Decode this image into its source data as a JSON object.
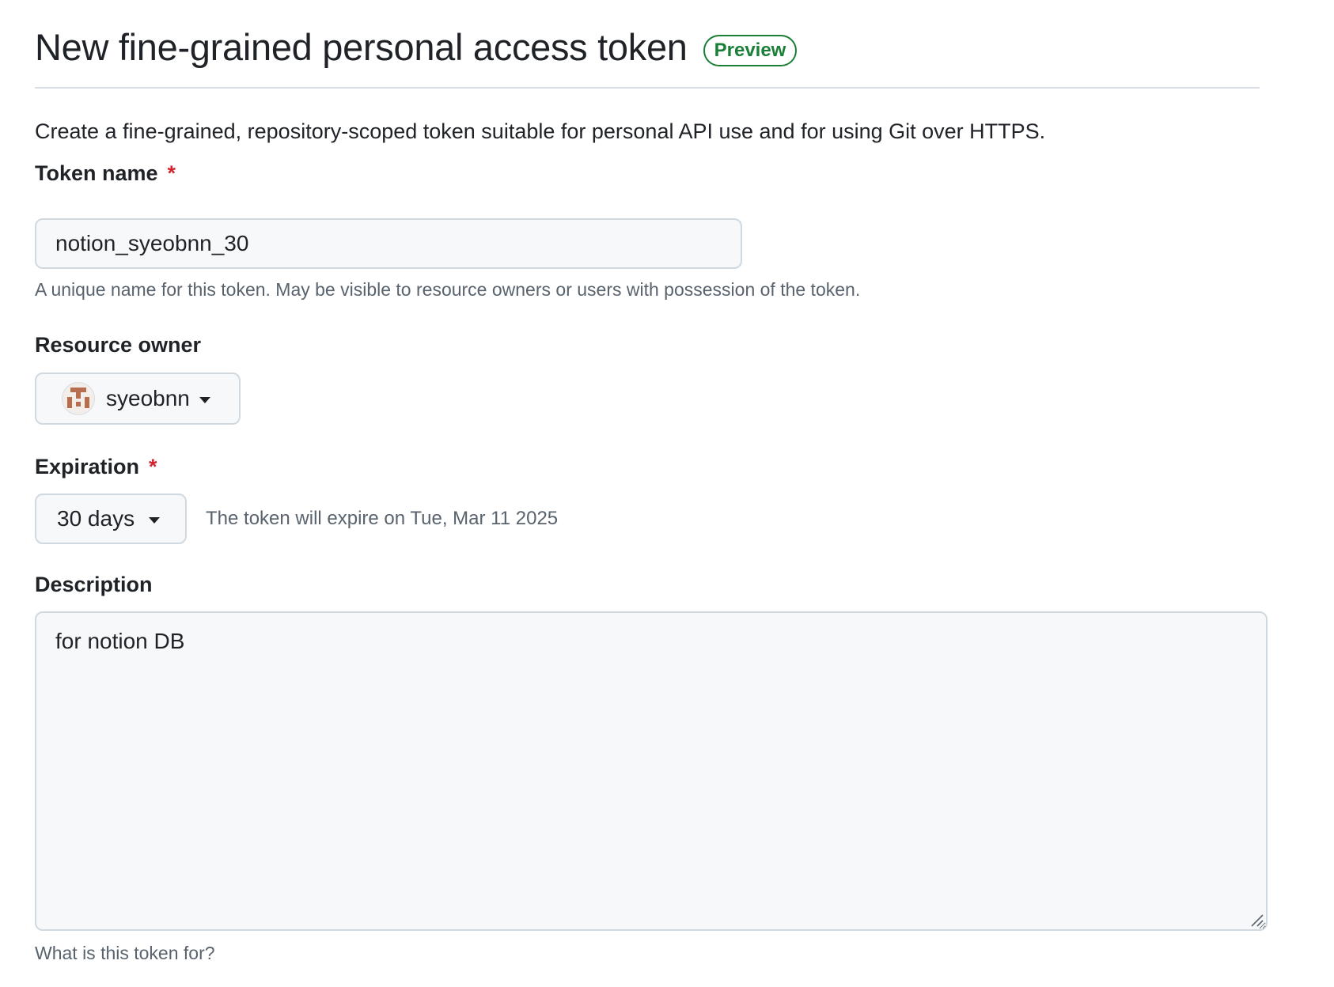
{
  "header": {
    "title": "New fine-grained personal access token",
    "badge": "Preview"
  },
  "intro": "Create a fine-grained, repository-scoped token suitable for personal API use and for using Git over HTTPS.",
  "token_name": {
    "label": "Token name",
    "required_mark": "*",
    "value": "notion_syeobnn_30",
    "hint": "A unique name for this token. May be visible to resource owners or users with possession of the token."
  },
  "resource_owner": {
    "label": "Resource owner",
    "selected": "syeobnn"
  },
  "expiration": {
    "label": "Expiration",
    "required_mark": "*",
    "selected": "30 days",
    "note": "The token will expire on Tue, Mar 11 2025"
  },
  "description": {
    "label": "Description",
    "value": "for notion DB",
    "hint": "What is this token for?"
  },
  "colors": {
    "accent_green": "#1a7f37",
    "required_red": "#d1242f",
    "input_bg": "#f6f8fa",
    "border": "#d1d9e0",
    "muted_text": "#59636e"
  },
  "icons": {
    "owner_avatar": "identicon-avatar",
    "dropdown": "caret-down-icon",
    "resize": "resize-handle-icon"
  }
}
